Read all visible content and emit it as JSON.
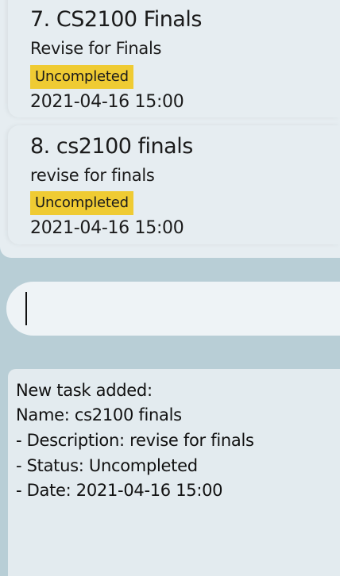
{
  "tasks": [
    {
      "title": "7. CS2100 Finals",
      "description": "Revise for Finals",
      "status": "Uncompleted",
      "date": "2021-04-16 15:00"
    },
    {
      "title": "8. cs2100 finals",
      "description": "revise for finals",
      "status": "Uncompleted",
      "date": "2021-04-16 15:00"
    }
  ],
  "command": {
    "value": ""
  },
  "result": {
    "lines": [
      "New task added:",
      "Name: cs2100 finals",
      "- Description: revise for finals",
      "- Status: Uncompleted",
      "- Date: 2021-04-16 15:00"
    ]
  },
  "colors": {
    "background": "#b8ced6",
    "panel": "#e6edf1",
    "status_uncompleted": "#efcb33"
  }
}
